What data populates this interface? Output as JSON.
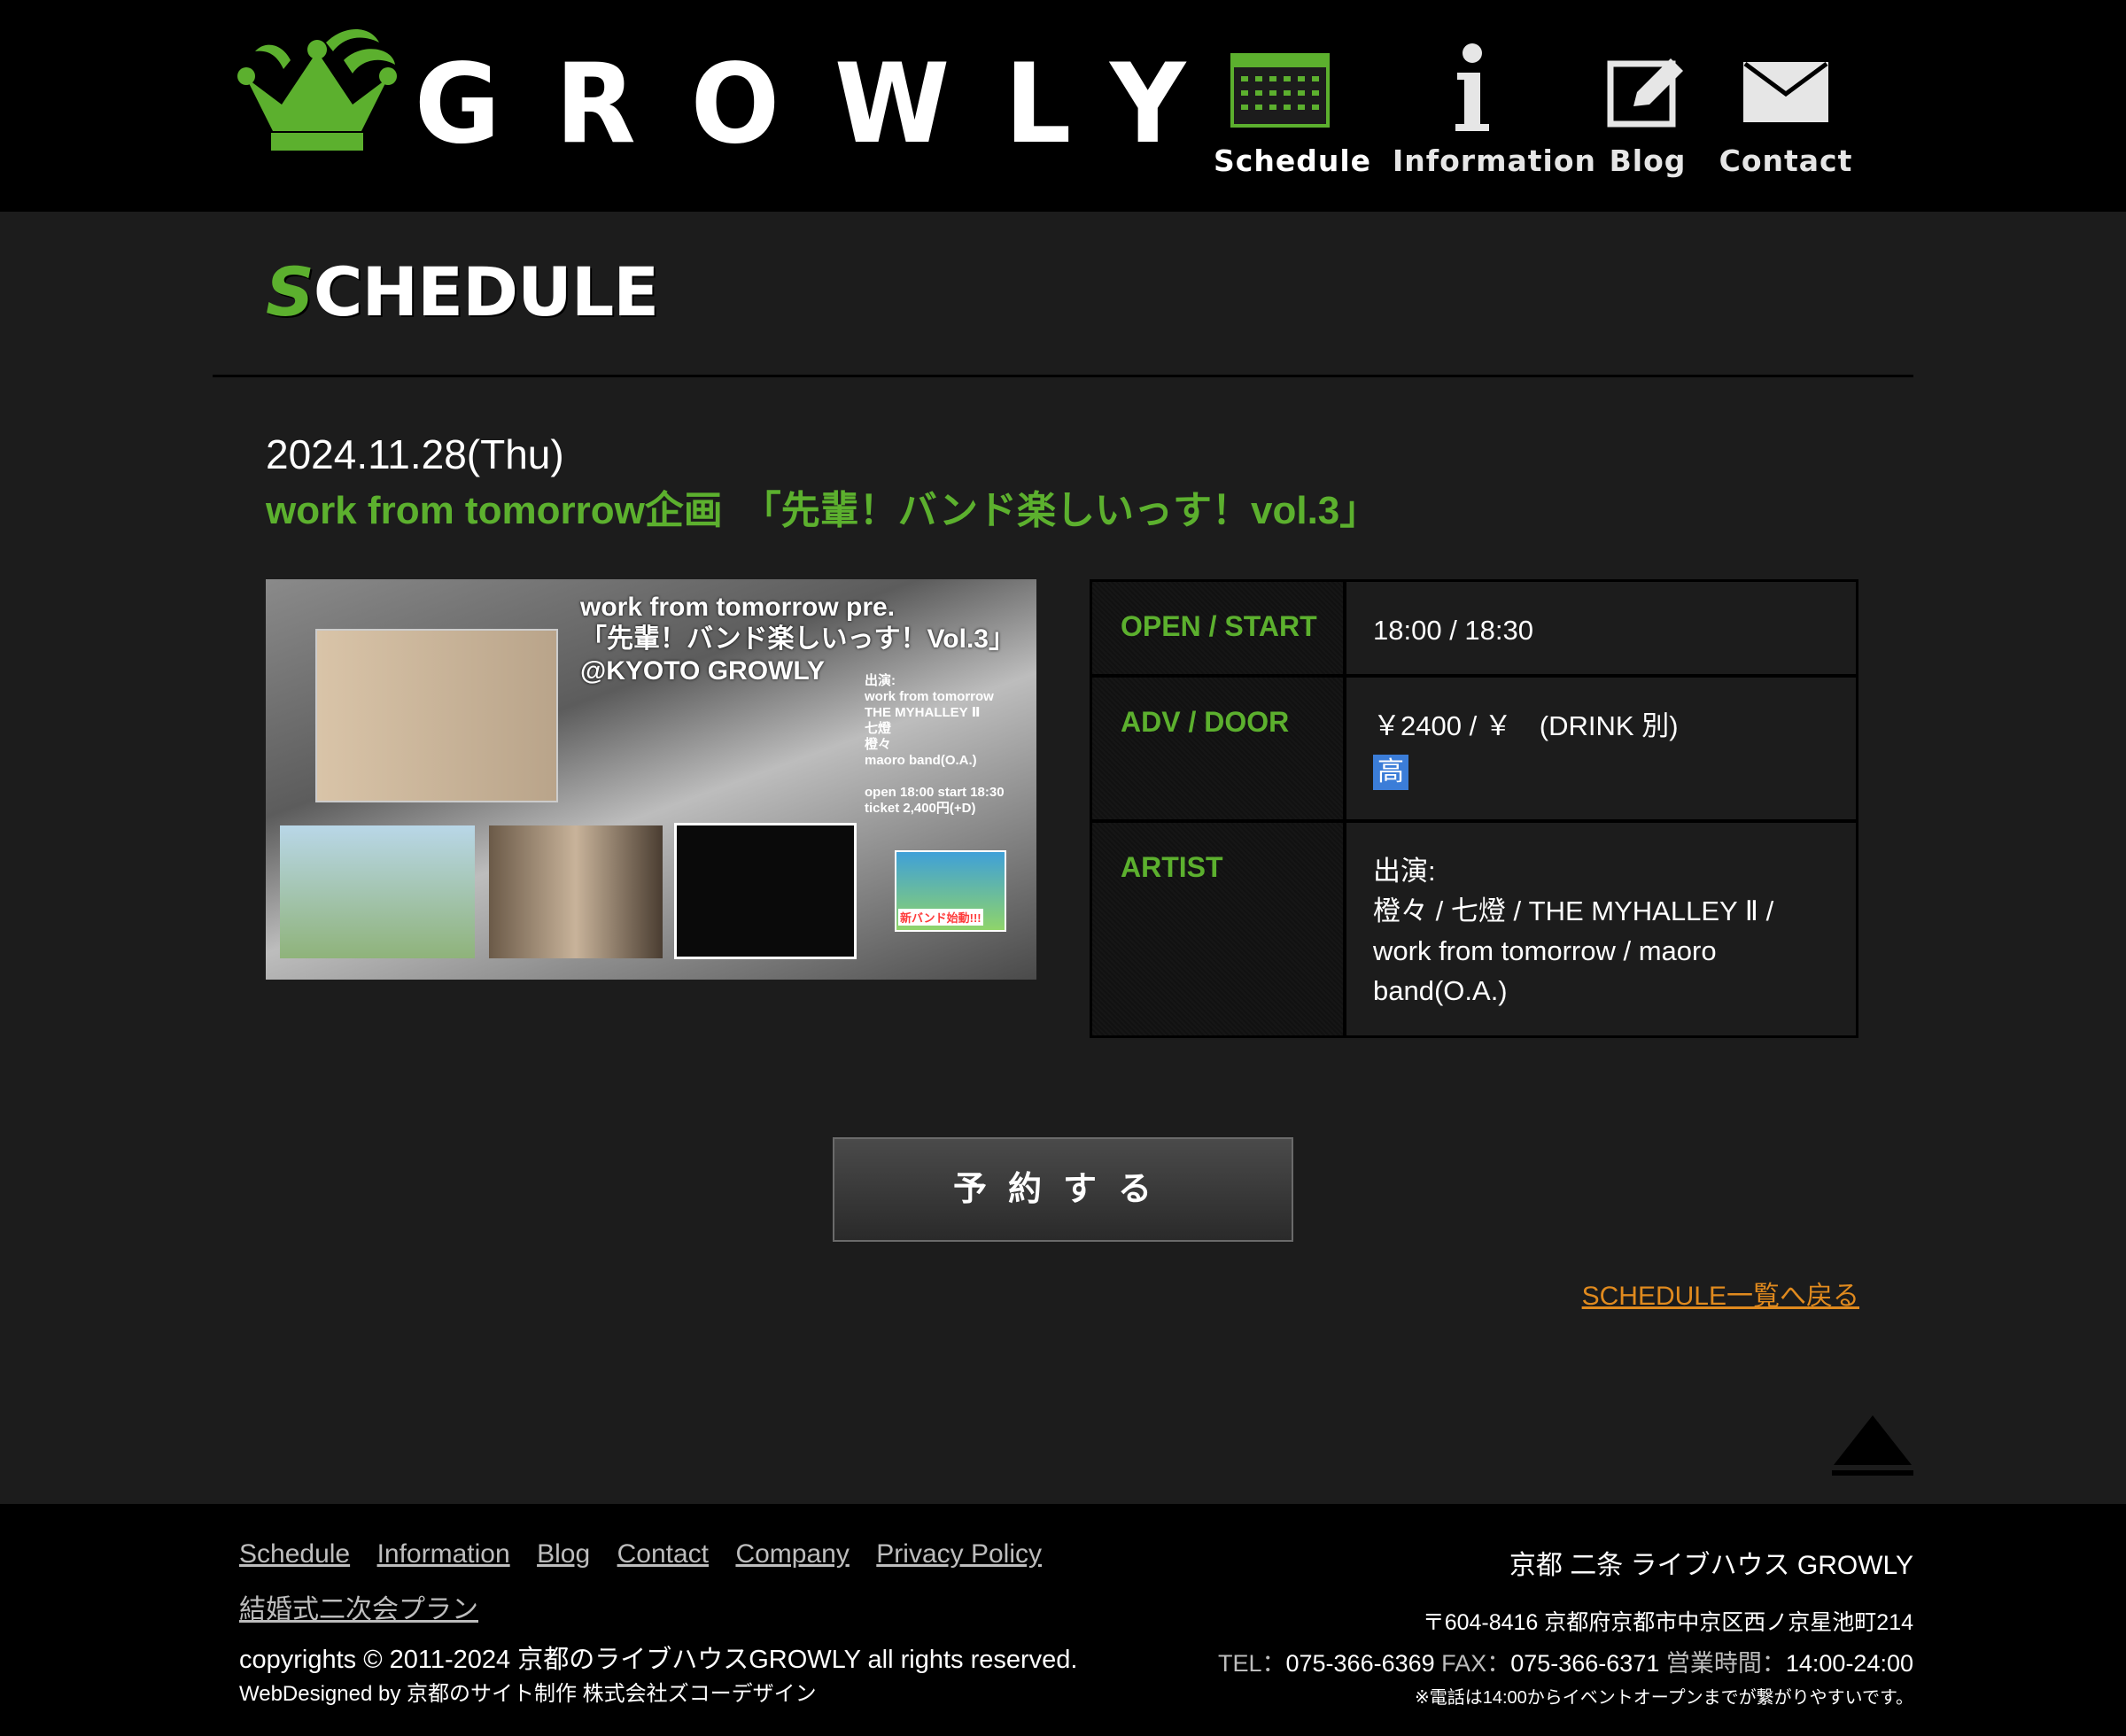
{
  "header": {
    "logo_text": "GROWLY",
    "nav": [
      {
        "label": "Schedule",
        "icon": "calendar-icon"
      },
      {
        "label": "Information",
        "icon": "info-icon"
      },
      {
        "label": "Blog",
        "icon": "pencil-edit-icon"
      },
      {
        "label": "Contact",
        "icon": "envelope-icon"
      }
    ]
  },
  "section": {
    "title_first": "S",
    "title_rest": "CHEDULE"
  },
  "event": {
    "date": "2024.11.28(Thu)",
    "title": "work from tomorrow企画　「先輩！バンド楽しいっす！vol.3」",
    "flyer": {
      "title_lines": [
        "work from tomorrow pre.",
        "「先輩！バンド楽しいっす！Vol.3」",
        "@KYOTO GROWLY"
      ],
      "info_lines": [
        "出演:",
        "work from tomorrow",
        "THE MYHALLEY Ⅱ",
        "七燈",
        "橙々",
        "maoro band(O.A.)",
        "",
        "open  18:00 start 18:30",
        "ticket 2,400円(+D)"
      ],
      "badge_text": "新バンド始動!!!"
    },
    "info": [
      {
        "key": "OPEN / START",
        "value": "18:00 / 18:30"
      },
      {
        "key": "ADV / DOOR",
        "value": "￥2400 / ￥　(DRINK 別)",
        "badge": "高"
      },
      {
        "key": "ARTIST",
        "value_lines": [
          "出演:",
          "橙々 / 七燈 / THE MYHALLEY Ⅱ /",
          "work from tomorrow / maoro",
          "band(O.A.)"
        ]
      }
    ],
    "reserve_label": "予約する",
    "back_link": "SCHEDULE一覧へ戻る"
  },
  "footer": {
    "links": [
      "Schedule",
      "Information",
      "Blog",
      "Contact",
      "Company",
      "Privacy Policy"
    ],
    "link2": "結婚式二次会プラン",
    "copyright": "copyrights © 2011-2024 京都のライブハウスGROWLY all rights reserved.",
    "designed": "WebDesigned by 京都のサイト制作 株式会社ズコーデザイン",
    "venue_name": "京都 二条 ライブハウス GROWLY",
    "address": "〒604-8416 京都府京都市中京区西ノ京星池町214",
    "tel_label": "TEL：",
    "tel": "075-366-6369",
    "fax_label": "FAX：",
    "fax": "075-366-6371",
    "hours_label": "営業時間：",
    "hours": "14:00-24:00",
    "note": "※電話は14:00からイベントオープンまでが繋がりやすいです。"
  },
  "colors": {
    "accent_green": "#5cb02e",
    "link_orange": "#e08a1e",
    "badge_blue": "#3b7dd8"
  }
}
